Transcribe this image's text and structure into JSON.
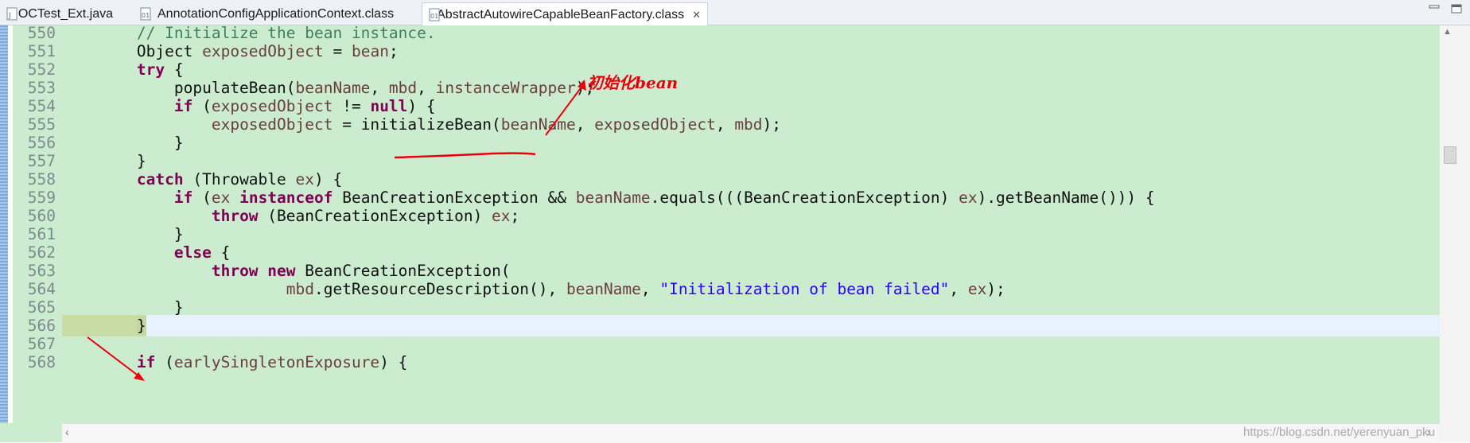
{
  "tabs": [
    {
      "label": "IOCTest_Ext.java",
      "icon": "java-file-icon",
      "active": false
    },
    {
      "label": "AnnotationConfigApplicationContext.class",
      "icon": "class-file-icon",
      "active": false
    },
    {
      "label": "AbstractAutowireCapableBeanFactory.class",
      "icon": "class-file-icon",
      "active": true
    }
  ],
  "code": {
    "lines": [
      {
        "num": "550",
        "text": "        // Initialize the bean instance."
      },
      {
        "num": "551",
        "text": "        Object exposedObject = bean;"
      },
      {
        "num": "552",
        "text": "        try {"
      },
      {
        "num": "553",
        "text": "            populateBean(beanName, mbd, instanceWrapper);"
      },
      {
        "num": "554",
        "text": "            if (exposedObject != null) {"
      },
      {
        "num": "555",
        "text": "                exposedObject = initializeBean(beanName, exposedObject, mbd);"
      },
      {
        "num": "556",
        "text": "            }"
      },
      {
        "num": "557",
        "text": "        }"
      },
      {
        "num": "558",
        "text": "        catch (Throwable ex) {"
      },
      {
        "num": "559",
        "text": "            if (ex instanceof BeanCreationException && beanName.equals(((BeanCreationException) ex).getBeanName())) {"
      },
      {
        "num": "560",
        "text": "                throw (BeanCreationException) ex;"
      },
      {
        "num": "561",
        "text": "            }"
      },
      {
        "num": "562",
        "text": "            else {"
      },
      {
        "num": "563",
        "text": "                throw new BeanCreationException("
      },
      {
        "num": "564",
        "text": "                        mbd.getResourceDescription(), beanName, \"Initialization of bean failed\", ex);"
      },
      {
        "num": "565",
        "text": "            }"
      },
      {
        "num": "566",
        "text": "        }"
      },
      {
        "num": "567",
        "text": ""
      },
      {
        "num": "568",
        "text": "        if (earlySingletonExposure) {"
      }
    ],
    "current_line": "566"
  },
  "annotation": {
    "label": "初始化bean",
    "color": "#e8000b"
  },
  "watermark": "https://blog.csdn.net/yerenyuan_pku",
  "colors": {
    "editor_bg": "#cbeccf",
    "current_line": "#e8f2fe",
    "keyword": "#7f0055",
    "comment": "#3f7f5f",
    "string": "#2a00ff",
    "field": "#6a3e3e"
  }
}
